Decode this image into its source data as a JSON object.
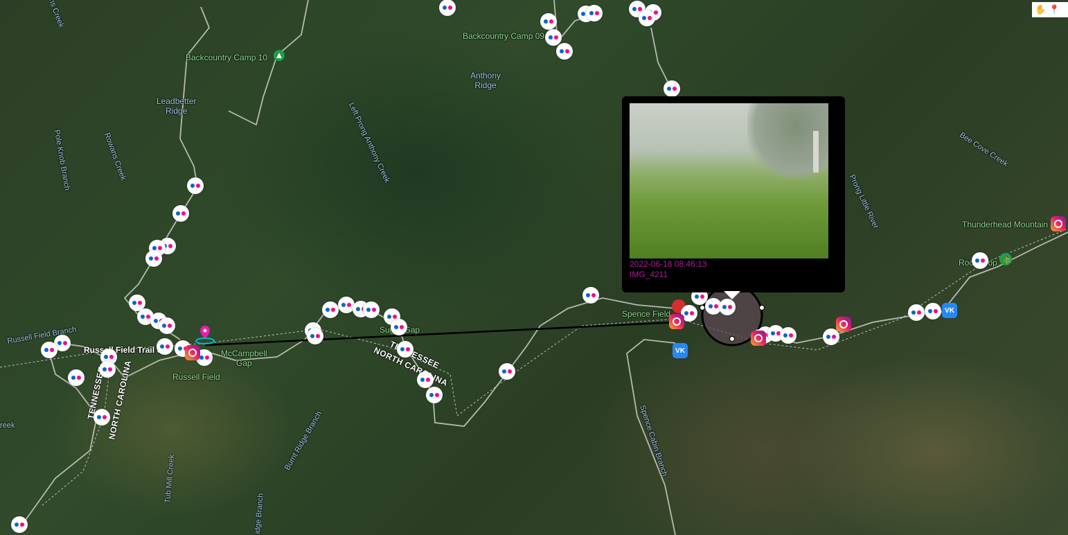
{
  "map": {
    "labels": {
      "backcountry_camp_10": "Backcountry Camp 10",
      "backcountry_camp_09": "Backcountry Camp 09",
      "anthony_ridge": "Anthony\nRidge",
      "leadbetter_ridge": "Leadbetter\nRidge",
      "left_prong_anthony_creek": "Left Prong Anthony Creek",
      "pole_knob_branch": "Pole Knob Branch",
      "rowans_creek": "Rowans Creek",
      "rowans_creek_top": "ans Creek",
      "bee_cove_creek": "Bee Cove Creek",
      "prong_little_river": "Prong Little River",
      "thunderhead_mountain": "Thunderhead Mountain",
      "rocky_top": "Rocky Top",
      "spence_field": "Spence Field",
      "russell_field_branch": "Russell Field Branch",
      "russell_field_trail": "Russell Field Trail S",
      "mccampbell_gap": "McCampbell\nGap",
      "russell_field": "Russell Field",
      "sugar_tree_gap": "Sugar Gap",
      "tennessee": "TENNESSEE",
      "north_carolina": "NORTH CAROLINA",
      "tennessee_left": "TENNESSEE",
      "north_carolina_left": "NORTH CAROLINA",
      "burnt_ridge_branch": "Burnt Ridge Branch",
      "tub_mill_creek": "Tub Mill Creek",
      "ridge_branch": "idge Branch",
      "spence_cabin_branch": "Spence Cabin Branch",
      "creek_left": "reek"
    },
    "icons": {
      "flickr": "flickr-marker-icon",
      "instagram": "instagram-marker-icon",
      "vk": "vk-marker-icon",
      "pin": "map-pin-icon",
      "campsite": "campsite-icon",
      "hiker": "hiker-icon"
    },
    "vk_label": "VK"
  },
  "popup": {
    "timestamp": "2022-06-18 08:46:13",
    "filename": "IMG_4211"
  },
  "toolbar": {
    "pan_icon": "hand-icon",
    "marker_icon": "marker-icon"
  },
  "colors": {
    "path_line": "#000000",
    "pin": "#e91eae",
    "popup_text": "#b0199a",
    "trail": "#d0d0c8"
  }
}
